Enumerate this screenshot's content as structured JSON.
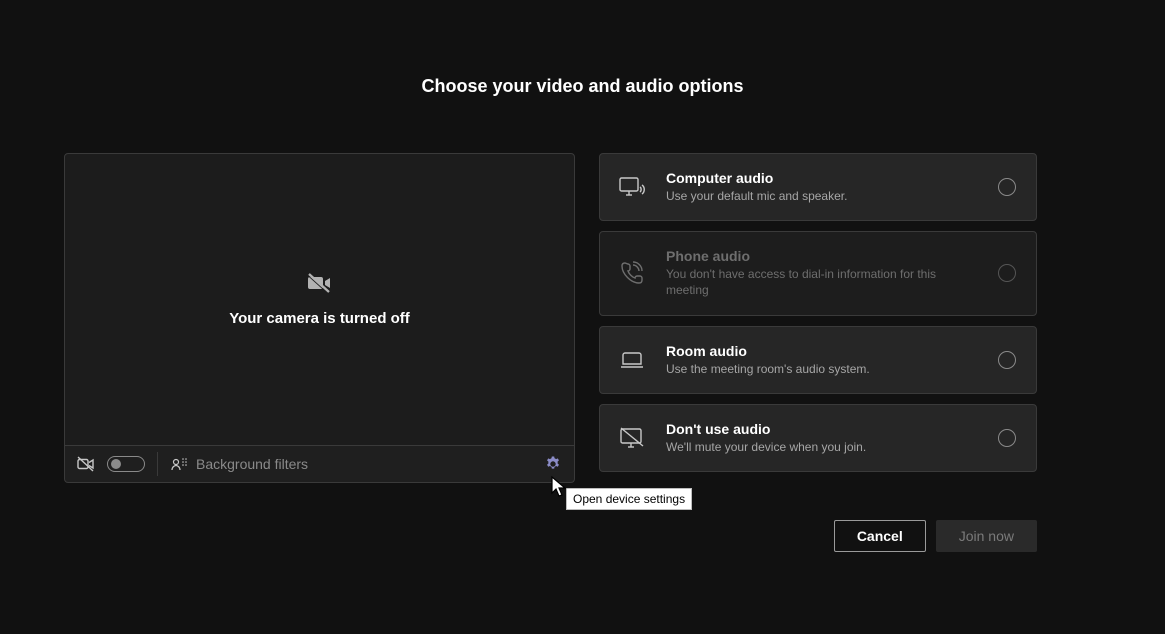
{
  "title": "Choose your video and audio options",
  "video": {
    "camera_off_text": "Your camera is turned off",
    "background_filters_label": "Background filters"
  },
  "audio_options": [
    {
      "key": "computer",
      "title": "Computer audio",
      "desc": "Use your default mic and speaker.",
      "disabled": false
    },
    {
      "key": "phone",
      "title": "Phone audio",
      "desc": "You don't have access to dial-in information for this meeting",
      "disabled": true
    },
    {
      "key": "room",
      "title": "Room audio",
      "desc": "Use the meeting room's audio system.",
      "disabled": false
    },
    {
      "key": "none",
      "title": "Don't use audio",
      "desc": "We'll mute your device when you join.",
      "disabled": false
    }
  ],
  "footer": {
    "cancel": "Cancel",
    "join": "Join now"
  },
  "tooltip": "Open device settings"
}
